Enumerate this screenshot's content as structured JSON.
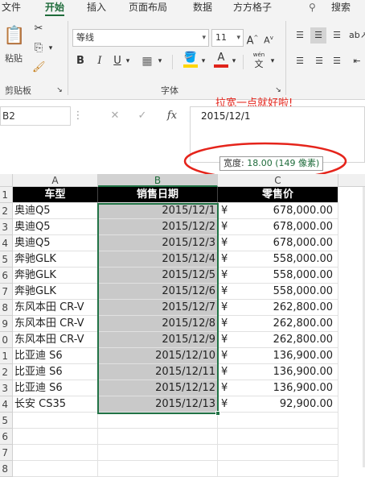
{
  "tabs": [
    "文件",
    "开始",
    "插入",
    "页面布局",
    "数据",
    "方方格子",
    "搜",
    "搜索"
  ],
  "ribbon": {
    "paste_label": "粘贴",
    "clipboard_group": "剪贴板",
    "font_name": "等线",
    "font_size": "11",
    "font_group": "字体",
    "wen_glyph": "wén",
    "wen_char": "文"
  },
  "formula_bar": {
    "name_box": "B2",
    "value": "2015/12/1",
    "fx": "fx"
  },
  "annotation": "拉宽一点就好啦!",
  "tooltip": {
    "label": "宽度: ",
    "value": "18.00 (149 像素)"
  },
  "columns": [
    "A",
    "B",
    "C"
  ],
  "header_row": [
    "车型",
    "销售日期",
    "零售价"
  ],
  "rows": [
    {
      "model": "奥迪Q5",
      "date": "2015/12/1",
      "yen": "¥",
      "price": "678,000.00"
    },
    {
      "model": "奥迪Q5",
      "date": "2015/12/2",
      "yen": "¥",
      "price": "678,000.00"
    },
    {
      "model": "奥迪Q5",
      "date": "2015/12/3",
      "yen": "¥",
      "price": "678,000.00"
    },
    {
      "model": "奔驰GLK",
      "date": "2015/12/4",
      "yen": "¥",
      "price": "558,000.00"
    },
    {
      "model": "奔驰GLK",
      "date": "2015/12/5",
      "yen": "¥",
      "price": "558,000.00"
    },
    {
      "model": "奔驰GLK",
      "date": "2015/12/6",
      "yen": "¥",
      "price": "558,000.00"
    },
    {
      "model": "东风本田 CR-V",
      "date": "2015/12/7",
      "yen": "¥",
      "price": "262,800.00"
    },
    {
      "model": "东风本田 CR-V",
      "date": "2015/12/8",
      "yen": "¥",
      "price": "262,800.00"
    },
    {
      "model": "东风本田 CR-V",
      "date": "2015/12/9",
      "yen": "¥",
      "price": "262,800.00"
    },
    {
      "model": "比亚迪 S6",
      "date": "2015/12/10",
      "yen": "¥",
      "price": "136,900.00"
    },
    {
      "model": "比亚迪 S6",
      "date": "2015/12/11",
      "yen": "¥",
      "price": "136,900.00"
    },
    {
      "model": "比亚迪 S6",
      "date": "2015/12/12",
      "yen": "¥",
      "price": "136,900.00"
    },
    {
      "model": "长安 CS35",
      "date": "2015/12/13",
      "yen": "¥",
      "price": "92,900.00"
    }
  ],
  "row_numbers": [
    "1",
    "2",
    "3",
    "4",
    "5",
    "6",
    "7",
    "8",
    "9",
    "0",
    "1",
    "2",
    "3",
    "4",
    "5",
    "6",
    "7",
    "8"
  ],
  "colors": {
    "accent": "#217346",
    "annotation": "#e5241b"
  }
}
